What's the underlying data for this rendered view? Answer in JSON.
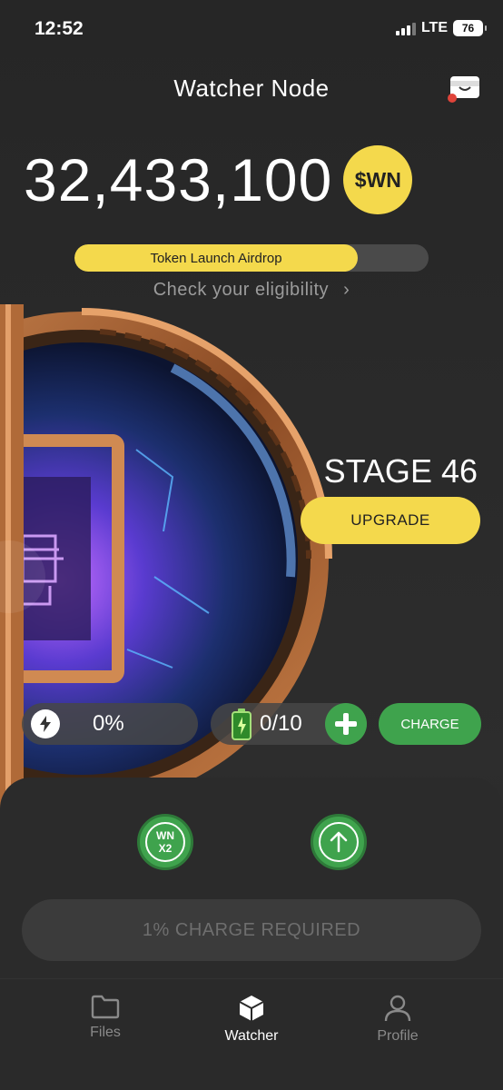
{
  "status_bar": {
    "time": "12:52",
    "network": "LTE",
    "battery": "76"
  },
  "header": {
    "title": "Watcher Node"
  },
  "balance": {
    "amount": "32,433,100",
    "token_symbol": "$WN"
  },
  "airdrop": {
    "label": "Token Launch Airdrop",
    "progress_percent": 80,
    "eligibility_link": "Check your eligibility"
  },
  "stage": {
    "label": "STAGE 46",
    "upgrade_button": "UPGRADE"
  },
  "stats": {
    "energy_value": "0%",
    "battery_value": "0/10",
    "charge_button": "CHARGE"
  },
  "actions": {
    "multiplier_top": "WN",
    "multiplier_bottom": "X2",
    "charge_required": "1% CHARGE REQUIRED"
  },
  "tabs": [
    {
      "label": "Files",
      "icon": "folder-icon"
    },
    {
      "label": "Watcher",
      "icon": "cube-icon",
      "active": true
    },
    {
      "label": "Profile",
      "icon": "person-icon"
    }
  ],
  "colors": {
    "accent_yellow": "#f4d94c",
    "accent_green": "#3fa34d",
    "background": "#262626"
  }
}
